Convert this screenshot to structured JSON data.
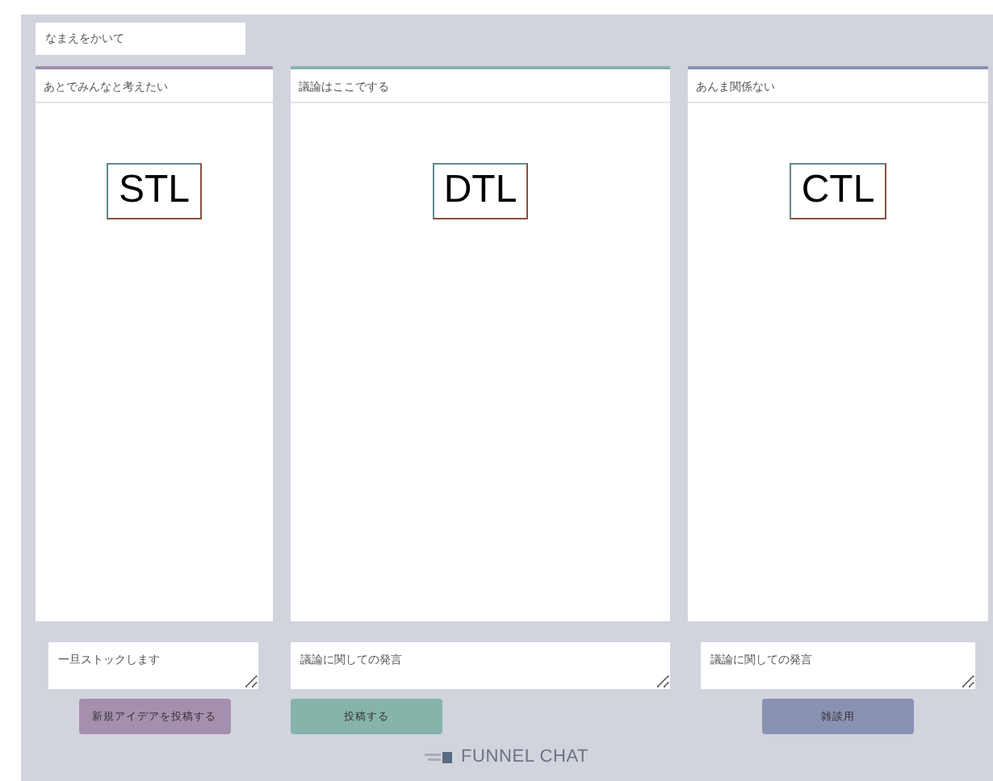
{
  "name_field": {
    "placeholder": "なまえをかいて"
  },
  "columns": [
    {
      "title": "あとでみんなと考えたい",
      "label": "STL",
      "color": "#a58fae",
      "input": {
        "placeholder": "一旦ストックします"
      },
      "button": "新規アイデアを投稿する"
    },
    {
      "title": "議論はここでする",
      "label": "DTL",
      "color": "#86b3aa",
      "input": {
        "placeholder": "議論に関しての発言"
      },
      "button": "投稿する"
    },
    {
      "title": "あんま関係ない",
      "label": "CTL",
      "color": "#8a92b3",
      "input": {
        "placeholder": "議論に関しての発言"
      },
      "button": "雑談用"
    }
  ],
  "footer": {
    "brand": "FUNNEL CHAT"
  }
}
